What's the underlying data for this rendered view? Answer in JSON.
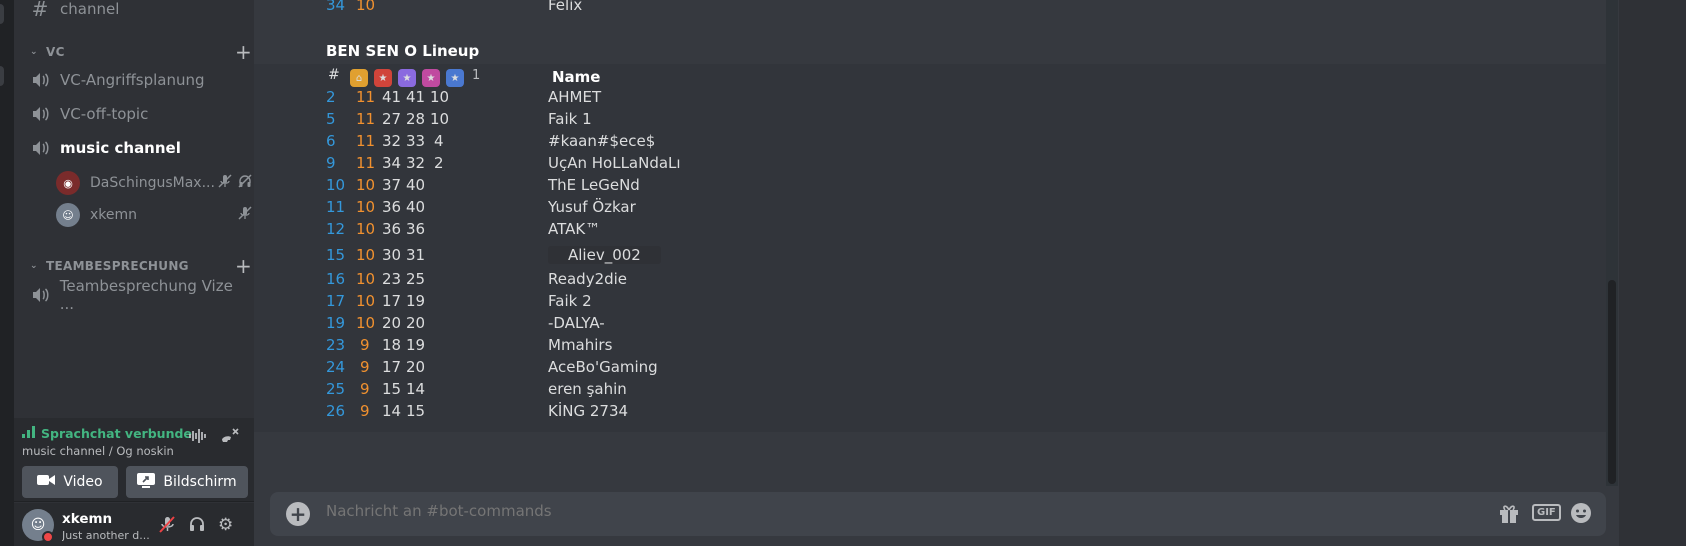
{
  "sidebar": {
    "top_channel": "channel",
    "categories": {
      "vc": "VC",
      "teambesprechung": "TEAMBESPRECHUNG"
    },
    "vc_channels": [
      "VC-Angriffsplanung",
      "VC-off-topic",
      "music channel"
    ],
    "vc_users": [
      "DaSchingusMax...",
      "xkemn"
    ],
    "team_channels": [
      "Teambesprechung Vize ..."
    ]
  },
  "voice_panel": {
    "status": "Sprachchat verbunden",
    "sub": "music channel / Og noskin",
    "video_label": "Video",
    "screen_label": "Bildschirm"
  },
  "user_panel": {
    "name": "xkemn",
    "sub": "Just another d..."
  },
  "messages": {
    "top_row": {
      "rank": "34",
      "lvl": "10",
      "name": "Felix"
    },
    "lineup_title": "BEN SEN O Lineup",
    "header": {
      "hash": "#",
      "sup": "1",
      "name": "Name"
    },
    "rows": [
      {
        "rank": "2",
        "lvl": "11",
        "a": "41",
        "b": "41",
        "c": "10",
        "name": "AHMET"
      },
      {
        "rank": "5",
        "lvl": "11",
        "a": "27",
        "b": "28",
        "c": "10",
        "name": "Faik 1"
      },
      {
        "rank": "6",
        "lvl": "11",
        "a": "32",
        "b": "33",
        "c": "4",
        "name": "#kaan#$ece$"
      },
      {
        "rank": "9",
        "lvl": "11",
        "a": "34",
        "b": "32",
        "c": "2",
        "name": "UçAn HoLLaNdaLı"
      },
      {
        "rank": "10",
        "lvl": "10",
        "a": "37",
        "b": "40",
        "c": "",
        "name": "ThE LeGeNd"
      },
      {
        "rank": "11",
        "lvl": "10",
        "a": "36",
        "b": "40",
        "c": "",
        "name": "Yusuf Özkar"
      },
      {
        "rank": "12",
        "lvl": "10",
        "a": "36",
        "b": "36",
        "c": "",
        "name": "ATAK™"
      },
      {
        "rank": "15",
        "lvl": "10",
        "a": "30",
        "b": "31",
        "c": "",
        "name": "Aliev_002"
      },
      {
        "rank": "16",
        "lvl": "10",
        "a": "23",
        "b": "25",
        "c": "",
        "name": "Ready2die"
      },
      {
        "rank": "17",
        "lvl": "10",
        "a": "17",
        "b": "19",
        "c": "",
        "name": "Faik 2"
      },
      {
        "rank": "19",
        "lvl": "10",
        "a": "20",
        "b": "20",
        "c": "",
        "name": "-DALYA-"
      },
      {
        "rank": "23",
        "lvl": "9",
        "a": "18",
        "b": "19",
        "c": "",
        "name": "Mmahirs"
      },
      {
        "rank": "24",
        "lvl": "9",
        "a": "17",
        "b": "20",
        "c": "",
        "name": "AceBo'Gaming"
      },
      {
        "rank": "25",
        "lvl": "9",
        "a": "15",
        "b": "14",
        "c": "",
        "name": "eren şahin"
      },
      {
        "rank": "26",
        "lvl": "9",
        "a": "14",
        "b": "15",
        "c": "",
        "name": "KİNG 2734"
      }
    ]
  },
  "composer": {
    "placeholder": "Nachricht an #bot-commands",
    "gif_label": "GIF"
  },
  "colors": {
    "rank": "#3498db",
    "level": "#f1912f",
    "voice_connected": "#43b581"
  }
}
